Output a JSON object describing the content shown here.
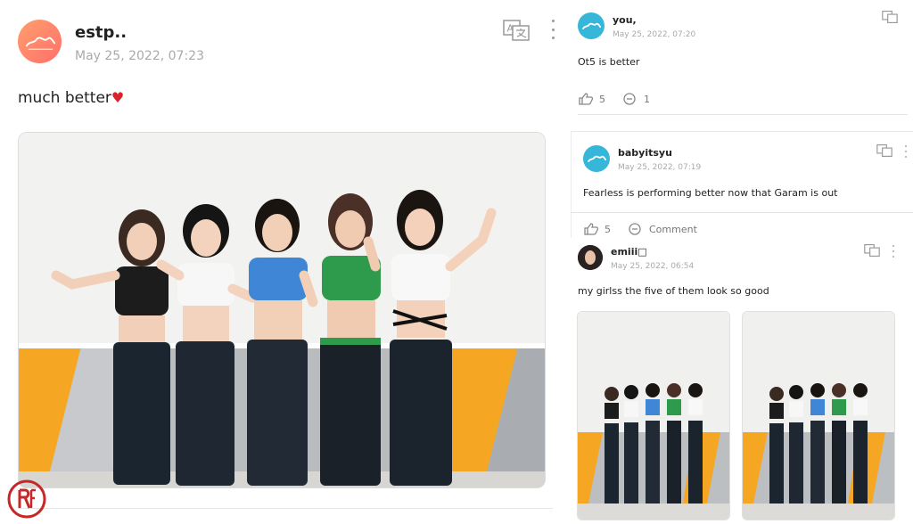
{
  "main_post": {
    "author": "estp..",
    "timestamp": "May 25, 2022, 07:23",
    "text": "much better",
    "heart": "♥",
    "translate_icon": "translate-icon",
    "more_icon": "more-vertical-icon"
  },
  "comments": [
    {
      "author": "you,",
      "timestamp": "May 25, 2022, 07:20",
      "text": "Ot5 is better",
      "likes": "5",
      "replies": "1"
    },
    {
      "author": "babyitsyu",
      "timestamp": "May 25, 2022, 07:19",
      "text": "Fearless is performing better now that Garam is out",
      "likes": "5",
      "replies": "Comment"
    },
    {
      "author": "emiii□",
      "timestamp": "May 25, 2022, 06:54",
      "text": "my girlss the five of them look so good"
    }
  ],
  "colors": {
    "accent_orange": "#ff8a65",
    "avatar_blue": "#36b6d8",
    "heart_red": "#d8232a",
    "watermark_red": "#c62828"
  }
}
